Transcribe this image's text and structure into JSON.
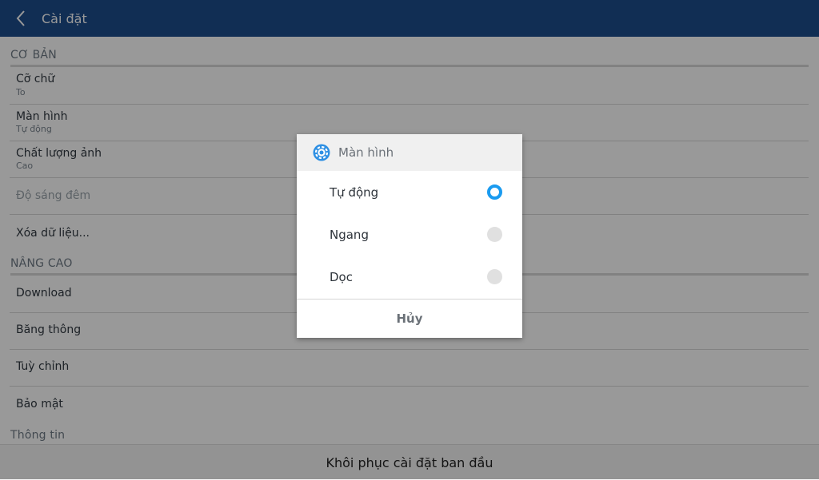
{
  "header": {
    "title": "Cài đặt",
    "back_icon": "chevron-left-icon"
  },
  "sections": {
    "basic": {
      "title": "CƠ BẢN",
      "items": [
        {
          "title": "Cỡ chữ",
          "subtitle": "To"
        },
        {
          "title": "Màn hình",
          "subtitle": "Tự động"
        },
        {
          "title": "Chất lượng ảnh",
          "subtitle": "Cao"
        },
        {
          "title": "Độ sáng đêm",
          "disabled": true
        },
        {
          "title": "Xóa dữ liệu..."
        }
      ]
    },
    "advanced": {
      "title": "NÂNG CAO",
      "items": [
        {
          "title": "Download"
        },
        {
          "title": "Băng thông"
        },
        {
          "title": "Tuỳ chỉnh"
        },
        {
          "title": "Bảo mật"
        }
      ]
    },
    "info": {
      "title": "Thông tin"
    }
  },
  "bottom_bar": {
    "label": "Khôi phục cài đặt ban đầu"
  },
  "dialog": {
    "title": "Màn hình",
    "icon": "gear-icon",
    "options": [
      {
        "label": "Tự động",
        "selected": true
      },
      {
        "label": "Ngang",
        "selected": false
      },
      {
        "label": "Dọc",
        "selected": false
      }
    ],
    "cancel_label": "Hủy"
  },
  "colors": {
    "header_bg": "#1d4d8d",
    "accent": "#1a9bf0",
    "overlay": "rgba(0,0,0,0.4)"
  }
}
